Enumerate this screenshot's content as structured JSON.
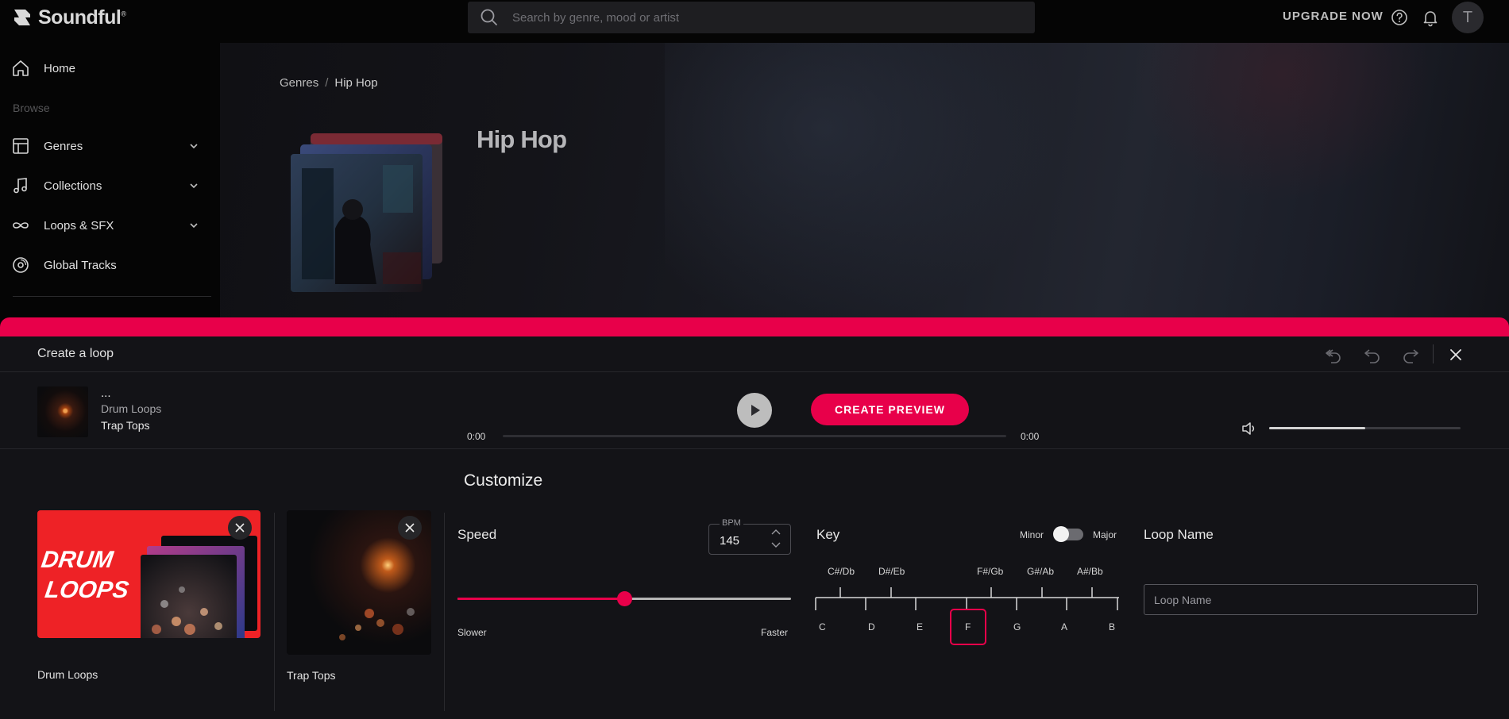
{
  "topbar": {
    "brand": "Soundful",
    "brand_mark": "®",
    "search_placeholder": "Search by genre, mood or artist",
    "upgrade_label": "UPGRADE NOW",
    "avatar_initial": "T"
  },
  "sidebar": {
    "home": "Home",
    "browse": "Browse",
    "items": [
      {
        "label": "Genres",
        "icon": "grid-icon",
        "expandable": true
      },
      {
        "label": "Collections",
        "icon": "music-note-icon",
        "expandable": true
      },
      {
        "label": "Loops & SFX",
        "icon": "infinity-icon",
        "expandable": true
      },
      {
        "label": "Global Tracks",
        "icon": "disc-icon",
        "expandable": false
      }
    ]
  },
  "hero": {
    "breadcrumb_root": "Genres",
    "breadcrumb_sep": "/",
    "breadcrumb_current": "Hip Hop",
    "title": "Hip Hop"
  },
  "panel": {
    "title": "Create a loop",
    "track": {
      "title": "...",
      "category": "Drum Loops",
      "name": "Trap Tops"
    },
    "play_label": "play",
    "create_preview": "CREATE PREVIEW",
    "time_start": "0:00",
    "time_end": "0:00",
    "progress": 0,
    "volume": 0.5,
    "customize": "Customize",
    "cards": [
      {
        "label": "Drum Loops",
        "art_text_1": "DRUM",
        "art_text_2": "LOOPS"
      },
      {
        "label": "Trap Tops"
      }
    ],
    "speed": {
      "label": "Speed",
      "bpm_caption": "BPM",
      "bpm": "145",
      "slower": "Slower",
      "faster": "Faster",
      "position": 0.5
    },
    "key": {
      "label": "Key",
      "minor": "Minor",
      "major": "Major",
      "mode_major": false,
      "sharps": [
        "C#/Db",
        "D#/Eb",
        "F#/Gb",
        "G#/Ab",
        "A#/Bb"
      ],
      "naturals": [
        "C",
        "D",
        "E",
        "F",
        "G",
        "A",
        "B"
      ],
      "selected": "F"
    },
    "loop_name": {
      "label": "Loop Name",
      "placeholder": "Loop Name"
    }
  },
  "colors": {
    "accent": "#e8004a",
    "background": "#131317"
  }
}
